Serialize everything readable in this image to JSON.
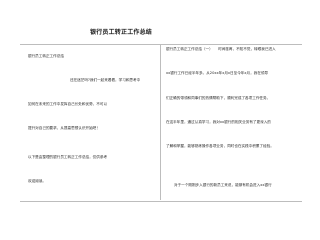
{
  "document": {
    "title": "银行员工转正工作总结",
    "left_column": [
      "银行员工转正工作总结",
      "还在迷茫吗?我们一起来看看，学习和思考中",
      "如何在未来的工作中发挥自己长处和优势，不可以",
      "提升对自己的要求，从提高思想认识开始吧！",
      "以下是由整理的银行员工转正工作总结，仅供参考",
      "欢迎阅读。"
    ],
    "right_column": [
      "银行员工转正工作总结（一）　　时间荏苒，不知不觉，转眼我已进入",
      "xx银行工作已经半年多。从20xx年x月x日至今年x月，我在领导",
      "们正确的带领和同事们的热情帮助下，顺利完成了各项工作任务。",
      "在这半年里，通过认真学习，我对xx银行的相关业务有了更深入的",
      "了解和掌握，能够熟练操作各项业务，同时也在实践中积累了经验。",
      "对于一个刚刚步入银行的新员工来说，能够有机会进入xx银行"
    ]
  }
}
